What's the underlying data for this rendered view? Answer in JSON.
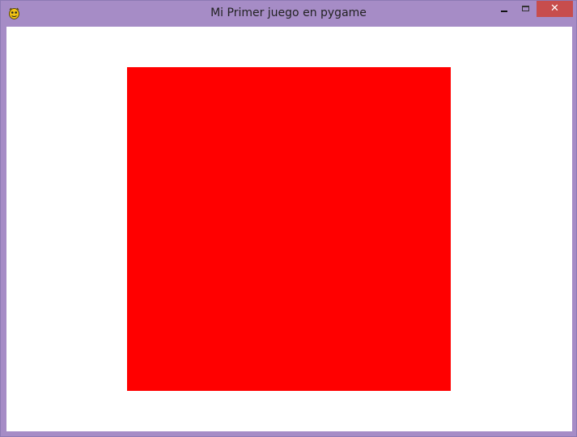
{
  "window": {
    "title": "Mi Primer juego en pygame",
    "frame_color": "#a68cc6",
    "controls": {
      "minimize_icon": "minimize-icon",
      "maximize_icon": "maximize-icon",
      "close_glyph": "✕"
    },
    "app_icon": "pygame-snake-icon"
  },
  "canvas": {
    "background": "#ffffff",
    "shape": "square",
    "shape_color": "#ff0000"
  }
}
